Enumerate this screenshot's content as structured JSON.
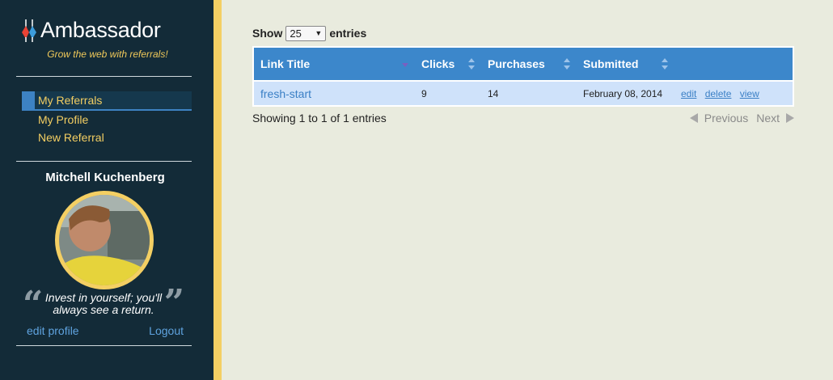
{
  "brand": {
    "name": "Ambassador",
    "tagline": "Grow the web with referrals!"
  },
  "sidebar": {
    "nav": [
      {
        "label": "My Referrals",
        "active": true
      },
      {
        "label": "My Profile",
        "active": false
      },
      {
        "label": "New Referral",
        "active": false
      }
    ],
    "user": {
      "name": "Mitchell Kuchenberg",
      "quote": "Invest in yourself; you'll always see a return.",
      "edit_profile": "edit profile",
      "logout": "Logout"
    }
  },
  "table_controls": {
    "show_label": "Show",
    "page_size": "25",
    "entries_label": "entries"
  },
  "table": {
    "columns": [
      "Link Title",
      "Clicks",
      "Purchases",
      "Submitted",
      ""
    ],
    "rows": [
      {
        "title": "fresh-start",
        "clicks": "9",
        "purchases": "14",
        "submitted": "February 08, 2014",
        "actions": [
          "edit",
          "delete",
          "view"
        ]
      }
    ]
  },
  "footer": {
    "info": "Showing 1 to 1 of 1 entries",
    "previous": "Previous",
    "next": "Next"
  },
  "colors": {
    "sidebar_bg": "#132b38",
    "accent_yellow": "#f4cf63",
    "header_blue": "#3c87cb",
    "row_blue": "#cfe2fa",
    "page_bg": "#e9ebde"
  }
}
